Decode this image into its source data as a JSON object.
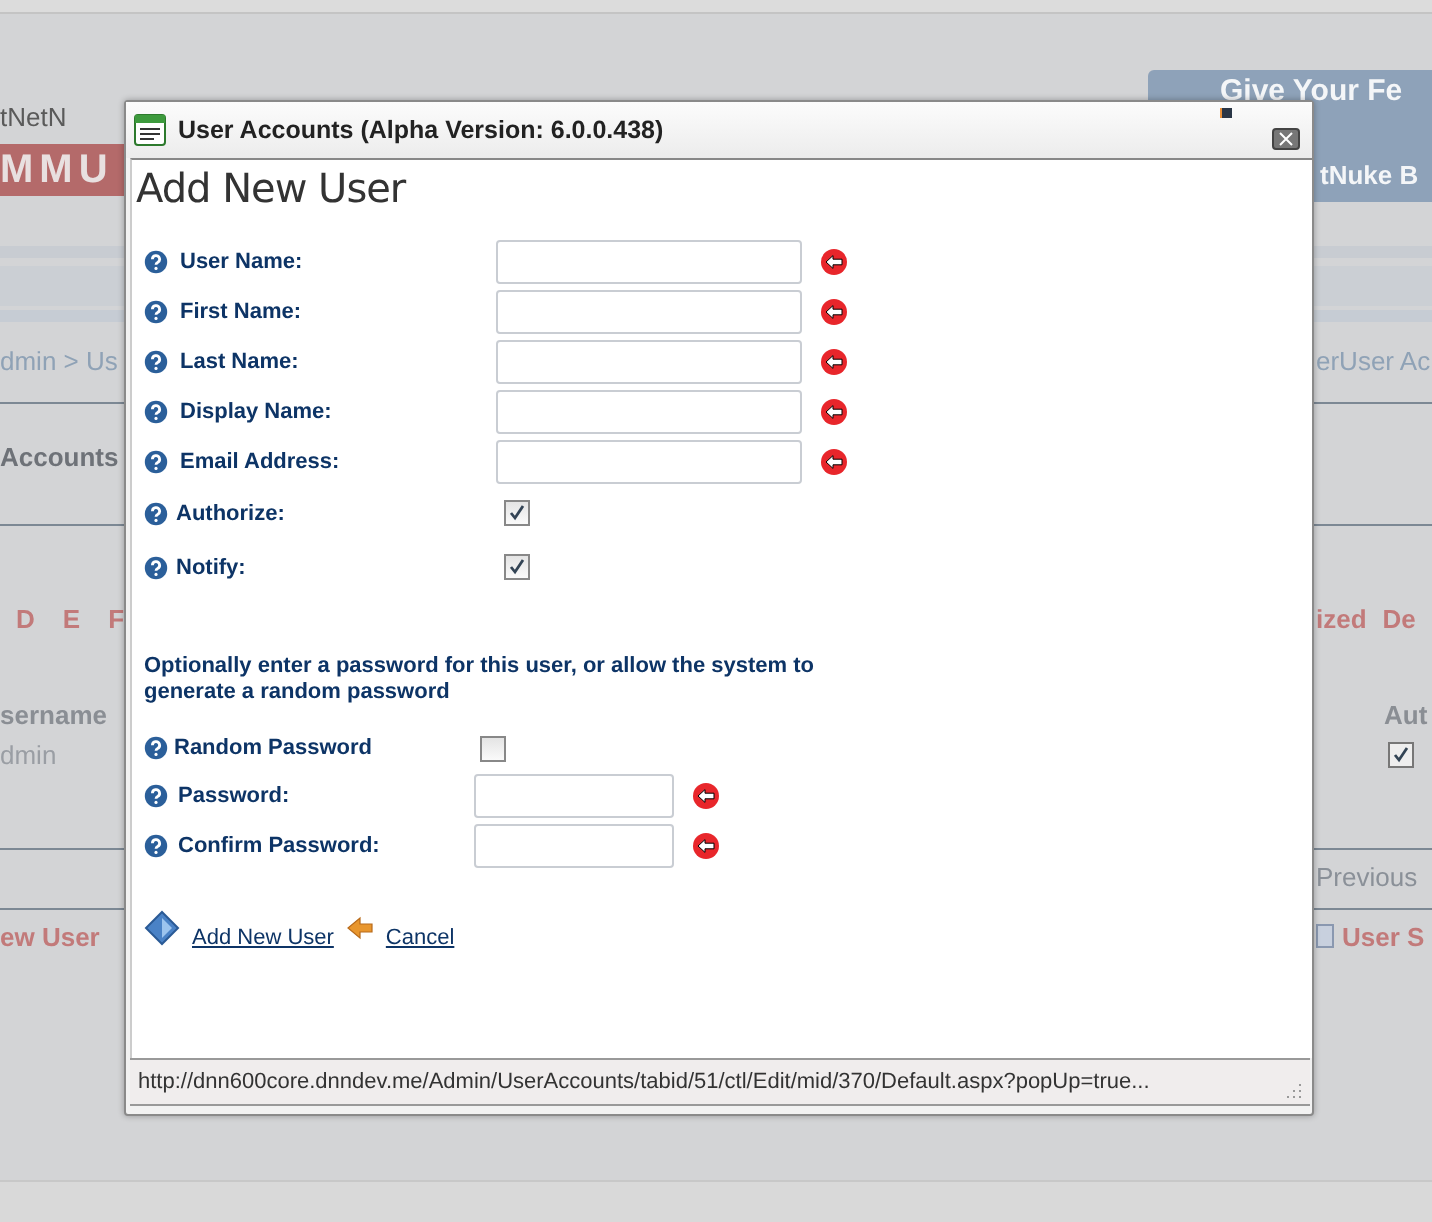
{
  "background": {
    "logo": {
      "top": "tNetN",
      "band": "MMU"
    },
    "banner": {
      "line_1": "Give Your Fe",
      "line_2": "tNuke B"
    },
    "breadcrumb": {
      "left": "dmin > Us",
      "right": "erUser Ac"
    },
    "heading": "Accounts",
    "letters": [
      "D",
      "E",
      "F"
    ],
    "filters": [
      "ized",
      "De"
    ],
    "column_left": "sername",
    "column_right": "Aut",
    "row": {
      "username": "dmin",
      "authorized": true
    },
    "pager": "Previous",
    "actions": [
      {
        "label": "ew User",
        "kind": "add"
      },
      {
        "label": "User S",
        "kind": "settings"
      }
    ]
  },
  "dialog": {
    "title": "User Accounts (Alpha Version: 6.0.0.438)",
    "heading": "Add New User",
    "fields": [
      {
        "kind": "text",
        "label": "User Name:",
        "required": true
      },
      {
        "kind": "text",
        "label": "First Name:",
        "required": true
      },
      {
        "kind": "text",
        "label": "Last Name:",
        "required": true
      },
      {
        "kind": "text",
        "label": "Display Name:",
        "required": true
      },
      {
        "kind": "text",
        "label": "Email Address:",
        "required": true
      },
      {
        "kind": "checkbox",
        "label": "Authorize:",
        "checked": true
      },
      {
        "kind": "checkbox",
        "label": "Notify:",
        "checked": true
      }
    ],
    "password_note": "Optionally enter a password for this user, or allow the system to generate a random password",
    "password_fields": [
      {
        "kind": "checkbox",
        "label": "Random Password",
        "checked": false
      },
      {
        "kind": "text",
        "label": "Password:",
        "required": true
      },
      {
        "kind": "text",
        "label": "Confirm Password:",
        "required": true
      }
    ],
    "actions": [
      {
        "kind": "add",
        "label": "Add New User"
      },
      {
        "kind": "cancel",
        "label": "Cancel"
      }
    ],
    "status_url": "http://dnn600core.dnndev.me/Admin/UserAccounts/tabid/51/ctl/Edit/mid/370/Default.aspx?popUp=true..."
  }
}
